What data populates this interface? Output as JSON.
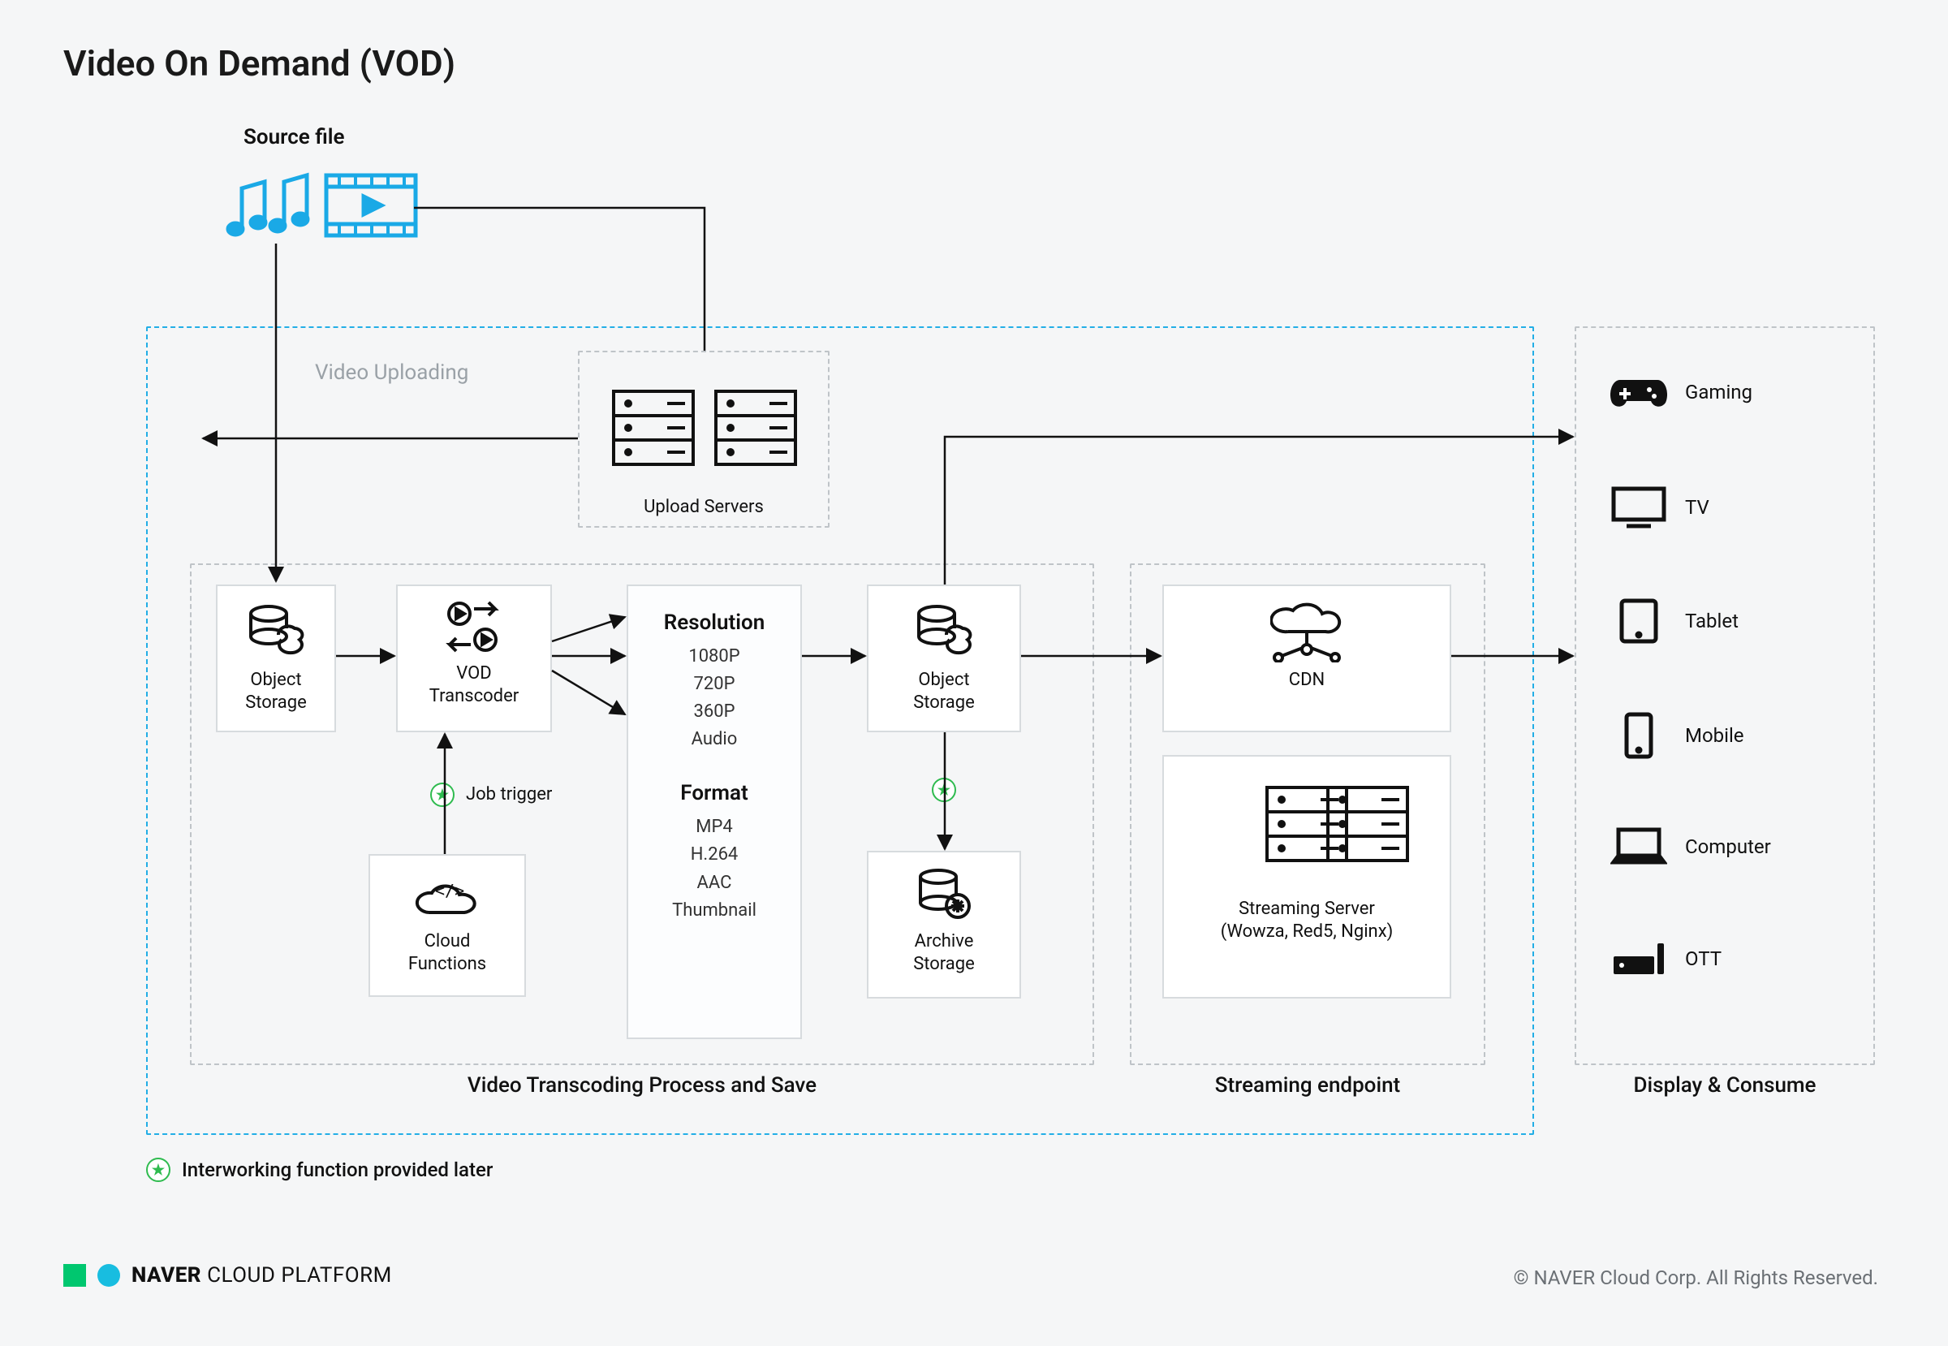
{
  "title": "Video On Demand (VOD)",
  "source": {
    "label": "Source file"
  },
  "zones": {
    "uploading_title": "Video Uploading",
    "transcoding_title": "Video Transcoding Process and Save",
    "streaming_title": "Streaming endpoint",
    "consume_title": "Display & Consume"
  },
  "nodes": {
    "upload_servers": "Upload Servers",
    "object_storage_a": "Object\nStorage",
    "vod_transcoder": "VOD\nTranscoder",
    "cloud_functions": "Cloud\nFunctions",
    "object_storage_b": "Object\nStorage",
    "archive_storage": "Archive\nStorage",
    "cdn": "CDN",
    "streaming_server": "Streaming Server\n(Wowza, Red5, Nginx)"
  },
  "job_trigger_label": "Job trigger",
  "resolution": {
    "heading": "Resolution",
    "items": [
      "1080P",
      "720P",
      "360P",
      "Audio"
    ]
  },
  "format": {
    "heading": "Format",
    "items": [
      "MP4",
      "H.264",
      "AAC",
      "Thumbnail"
    ]
  },
  "devices": [
    "Gaming",
    "TV",
    "Tablet",
    "Mobile",
    "Computer",
    "OTT"
  ],
  "legend": "Interworking function provided later",
  "footer": {
    "brand_bold": "NAVER",
    "brand_rest": "CLOUD PLATFORM",
    "copyright": "© NAVER Cloud Corp. All Rights Reserved."
  },
  "colors": {
    "cyan": "#23aee6",
    "graydash": "#bfc4c8",
    "accent": "#2fbb4f",
    "ink": "#111"
  }
}
